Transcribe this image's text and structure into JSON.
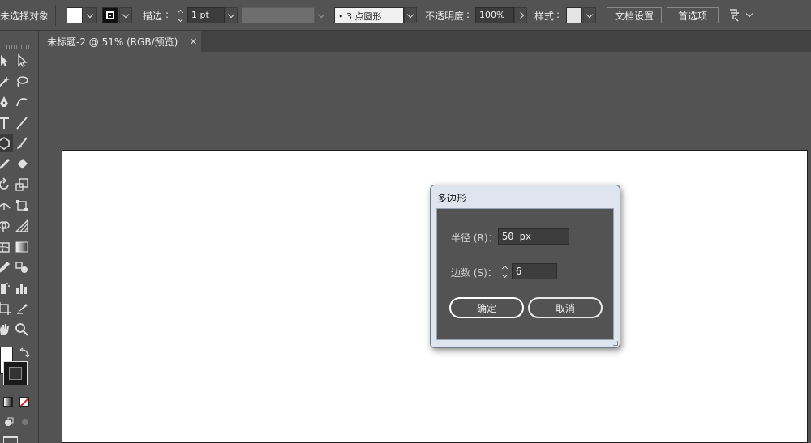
{
  "control_bar": {
    "selection_label": "未选择对象",
    "stroke_label": "描边",
    "stroke_value": "1 pt",
    "brush_value": "•  3 点圆形",
    "opacity_label": "不透明度",
    "opacity_value": "100%",
    "style_label": "样式",
    "doc_setup_button": "文档设置",
    "preferences_button": "首选项",
    "colon": ":"
  },
  "tabs": [
    {
      "title": "未标题-2 @ 51% (RGB/预览)",
      "close": "×"
    }
  ],
  "tools": [
    "selection-tool-icon",
    "direct-selection-tool-icon",
    "magic-wand-icon",
    "lasso-icon",
    "pen-tool-icon",
    "curvature-tool-icon",
    "type-tool-icon",
    "line-tool-icon",
    "polygon-tool-icon",
    "paintbrush-icon",
    "pencil-icon",
    "eraser-icon",
    "rotate-tool-icon",
    "scale-tool-icon",
    "width-tool-icon",
    "free-transform-icon",
    "shape-builder-icon",
    "perspective-grid-icon",
    "mesh-tool-icon",
    "gradient-tool-icon",
    "eyedropper-icon",
    "blend-tool-icon",
    "symbol-sprayer-icon",
    "column-graph-icon",
    "artboard-tool-icon",
    "slice-tool-icon",
    "hand-tool-icon",
    "zoom-tool-icon"
  ],
  "colors": {
    "fill": "#ffffff",
    "stroke": "#1a1a1a",
    "canvas": "#ffffff",
    "workspace": "#535353"
  },
  "dialog": {
    "title": "多边形",
    "radius_label": "半径 (R)：",
    "radius_value": "50 px",
    "sides_label": "边数 (S)：",
    "sides_value": "6",
    "ok_button": "确定",
    "cancel_button": "取消"
  }
}
